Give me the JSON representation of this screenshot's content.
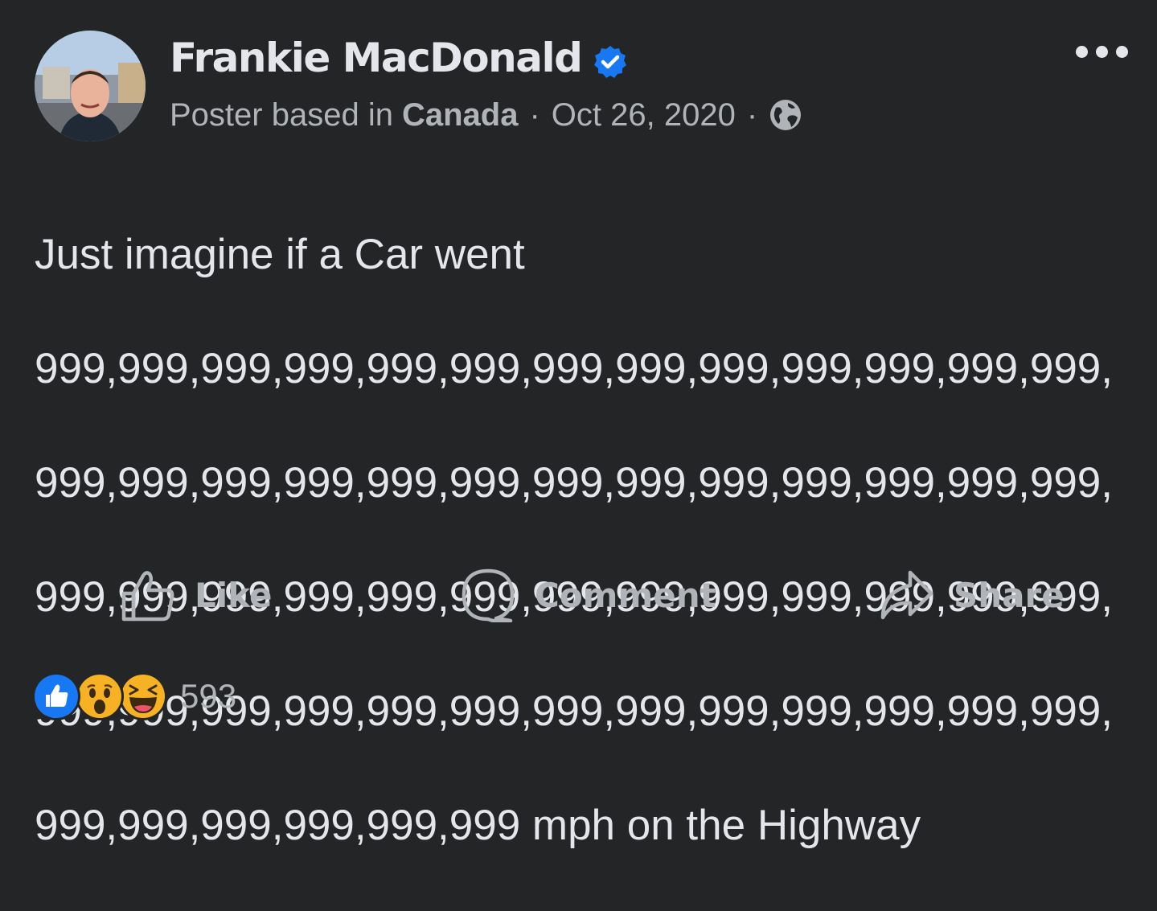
{
  "post": {
    "author_name": "Frankie MacDonald",
    "meta": {
      "prefix": "Poster based in",
      "country": "Canada",
      "separator": "·",
      "date": "Oct 26, 2020",
      "audience_icon": "globe-icon"
    },
    "text_lines": [
      "Just imagine if a Car went",
      "999,999,999,999,999,999,999,999,999,999,999,999,999,",
      "999,999,999,999,999,999,999,999,999,999,999,999,999,",
      "999,999,999,999,999,999,999,999,999,999,999,999,999,",
      "999,999,999,999,999,999,999,999,999,999,999,999,999,",
      "999,999,999,999,999,999 mph on the Highway"
    ]
  },
  "actions": {
    "like_label": "Like",
    "comment_label": "Comment",
    "share_label": "Share"
  },
  "reactions": {
    "types": [
      "like",
      "wow",
      "haha"
    ],
    "count": "593"
  },
  "colors": {
    "background": "#242526",
    "primary_text": "#e4e6eb",
    "secondary_text": "#b0b3b8",
    "verified_blue": "#1877f2"
  }
}
